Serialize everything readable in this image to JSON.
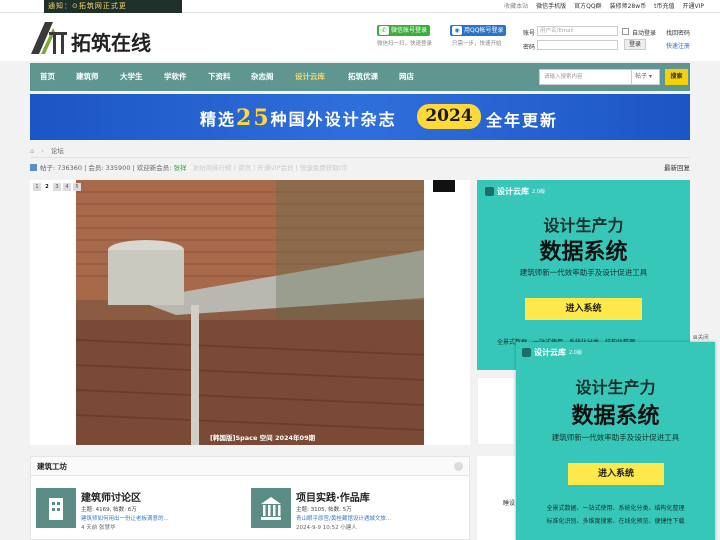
{
  "topbar": {
    "notice": "通知：⊙拓筑网正式更",
    "links": [
      "收藏本站",
      "微信手机版",
      "官方QQ群",
      "装修师28w币",
      "t币充值",
      "开通VIP"
    ]
  },
  "header": {
    "logo": "拓筑在线",
    "wechat_login": "微信账号登录",
    "wechat_icon": "wechat-icon",
    "wechat_sub": "微信扫一扫，快速登录",
    "qq_login": "用QQ帐号登录",
    "qq_icon": "qq-icon",
    "qq_sub": "只需一步，快速开始",
    "account_label": "账号",
    "account_placeholder": "用户名/Email",
    "password_label": "密码",
    "auto_login": "自动登录",
    "find_password": "找回密码",
    "login_button": "登录",
    "quick_register": "快速注册"
  },
  "nav": {
    "items": [
      "首页",
      "建筑师",
      "大学生",
      "学软件",
      "下资料",
      "杂志阁",
      "设计云库",
      "拓筑优课",
      "网店"
    ],
    "active_index": 6,
    "search_placeholder": "请输入搜索内容",
    "search_scope": "帖子",
    "search_button": "搜索"
  },
  "banner": {
    "pre": "精选",
    "number": "25",
    "mid": "种国外设计杂志",
    "year": "2024",
    "tail": "全年更新"
  },
  "breadcrumb": {
    "home_icon": "home-icon",
    "sep": "›",
    "current": "论坛"
  },
  "stats": {
    "text": "帖子: 736360  |  会员: 335900  |  欢迎新会员: ",
    "new_member": "张祥",
    "faded": "发帖周排行榜 | 资讯 | 开通VIP会员 | 快速免费获取t币",
    "latest": "最新回复"
  },
  "slideshow": {
    "pages": [
      "1",
      "2",
      "3",
      "4",
      "5"
    ],
    "active_page": 1,
    "caption": "[韩国版]Space 空间 2024年09期",
    "progress": 0.4
  },
  "ad": {
    "brand": "设计云库",
    "version": "2.0版",
    "line1": "设计生产力",
    "line2": "数据系统",
    "line3": "建筑师新一代效率助手及设计促进工具",
    "button": "进入系统",
    "features1": "全景式数据、一站式使用、系统化分类、结构化整理",
    "features2": "标准化识别、多维度搜索、在线化预览、便捷性下载",
    "close": "关闭"
  },
  "forum": {
    "section_title": "建筑工坊",
    "boards": [
      {
        "title": "建筑师讨论区",
        "meta": "主题: 4169, 帖数: 6万",
        "sub": "建筑师如何用出一份让老板满意的...",
        "last": "4 天前 张慧华",
        "icon": "building-icon"
      },
      {
        "title": "项目实践·作品库",
        "meta": "主题: 3105, 帖数: 5万",
        "sub": "青山眼平原宫/黄桂藏馆设计遇城文旅...",
        "last": "2024-9-9 10:52 小建人",
        "icon": "temple-icon"
      }
    ],
    "side_label": "睡设"
  },
  "colors": {
    "nav_bg": "#5f9690",
    "accent_yellow": "#f5d10a",
    "ad_bg": "#36c7b8",
    "banner_blue": "#1c55c4"
  }
}
